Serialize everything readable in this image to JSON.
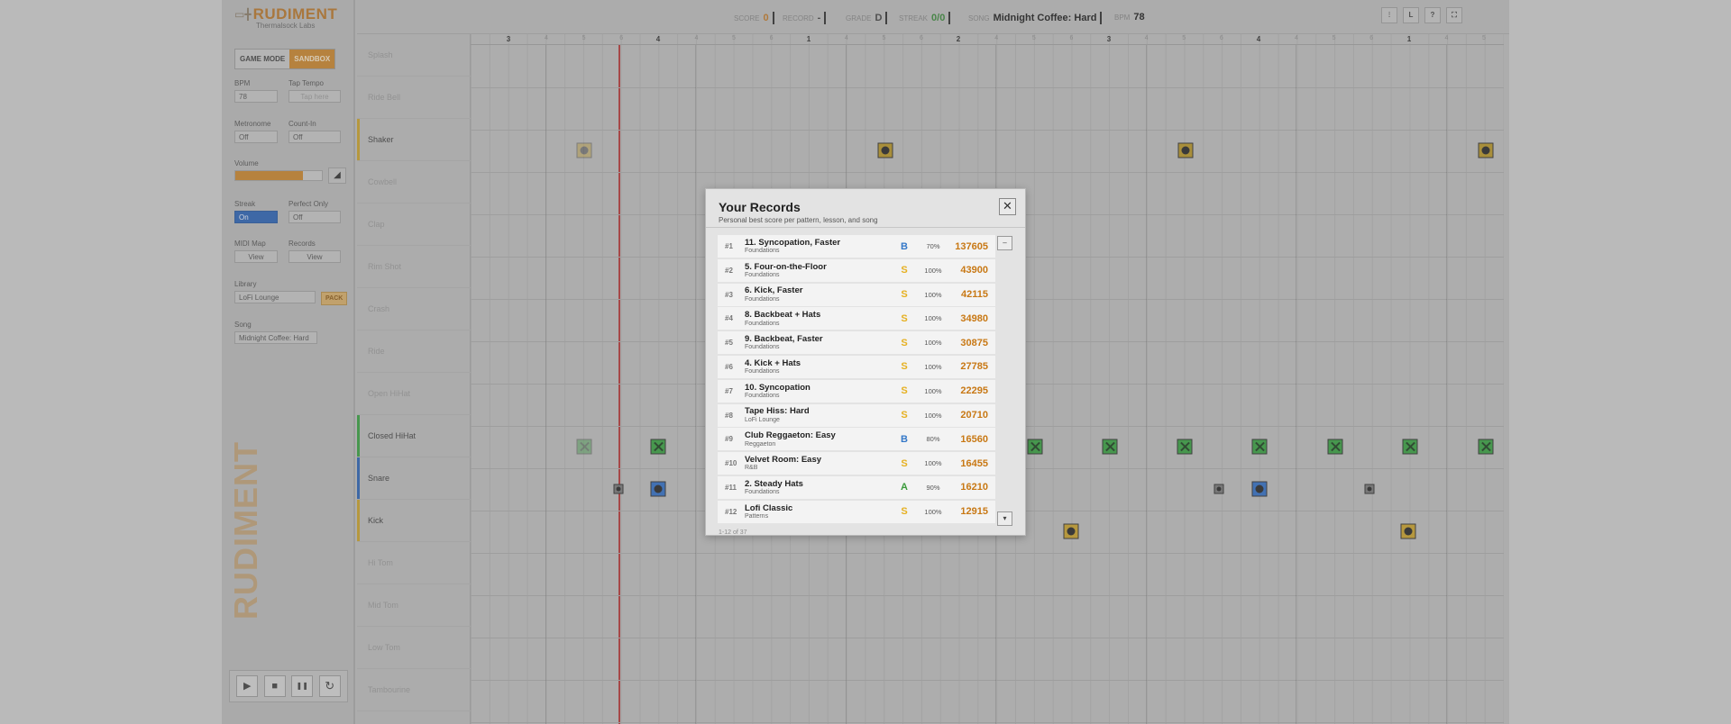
{
  "brand": {
    "name": "RUDIMENT",
    "sub": "Thermalsock Labs",
    "vertical": "RUDIMENT"
  },
  "modes": {
    "game": "GAME MODE",
    "sandbox": "SANDBOX"
  },
  "controls": {
    "bpm_label": "BPM",
    "bpm_value": "78",
    "tap_label": "Tap Tempo",
    "tap_placeholder": "Tap here",
    "metronome_label": "Metronome",
    "metronome_value": "Off",
    "countin_label": "Count-In",
    "countin_value": "Off",
    "volume_label": "Volume",
    "volume_level": 0.78,
    "streak_label": "Streak",
    "streak_value": "On",
    "perfect_label": "Perfect Only",
    "perfect_value": "Off",
    "midi_label": "MIDI Map",
    "midi_btn": "View",
    "records_label": "Records",
    "records_btn": "View",
    "library_label": "Library",
    "library_value": "LoFi Lounge",
    "pack_btn": "PACK",
    "song_label": "Song",
    "song_value": "Midnight Coffee: Hard"
  },
  "transport": {
    "play": "▶",
    "stop": "■",
    "pause": "❚❚",
    "loop": "↻"
  },
  "topbar": {
    "score_label": "SCORE",
    "score_value": "0",
    "record_label": "RECORD",
    "record_value": "-",
    "grade_label": "GRADE",
    "grade_value": "D",
    "streak_label": "STREAK",
    "streak_value": "0/0",
    "song_label": "SONG",
    "song_value": "Midnight Coffee: Hard",
    "bpm_label": "BPM",
    "bpm_value": "78",
    "btn_l": "L",
    "btn_help": "?"
  },
  "lanes": [
    "Splash",
    "Ride Bell",
    "Shaker",
    "Cowbell",
    "Clap",
    "Rim Shot",
    "Crash",
    "Ride",
    "Open HiHat",
    "Closed HiHat",
    "Snare",
    "Kick",
    "Hi Tom",
    "Mid Tom",
    "Low Tom",
    "Tambourine"
  ],
  "ruler": [
    "3",
    "4",
    "1",
    "2",
    "3",
    "4",
    "1"
  ],
  "ruler_minor": [
    "4",
    "5",
    "6",
    "4",
    "5",
    "6",
    "4",
    "5",
    "6",
    "4",
    "5",
    "6",
    "4",
    "5",
    "6",
    "4",
    "5",
    "6",
    "4",
    "5"
  ],
  "colors": {
    "accent": "#c8862f",
    "blue": "#2f64b4",
    "hihat_green": "#3aa043",
    "playhead": "#b43a3a"
  },
  "modal": {
    "title": "Your Records",
    "subtitle": "Personal best score per pattern, lesson, and song",
    "footer": "1-12 of 37",
    "rows": [
      {
        "rank": "#1",
        "name": "11. Syncopation, Faster",
        "cat": "Foundations",
        "grade": "B",
        "pct": "70%",
        "score": "137605"
      },
      {
        "rank": "#2",
        "name": "5. Four-on-the-Floor",
        "cat": "Foundations",
        "grade": "S",
        "pct": "100%",
        "score": "43900"
      },
      {
        "rank": "#3",
        "name": "6. Kick, Faster",
        "cat": "Foundations",
        "grade": "S",
        "pct": "100%",
        "score": "42115"
      },
      {
        "rank": "#4",
        "name": "8. Backbeat + Hats",
        "cat": "Foundations",
        "grade": "S",
        "pct": "100%",
        "score": "34980"
      },
      {
        "rank": "#5",
        "name": "9. Backbeat, Faster",
        "cat": "Foundations",
        "grade": "S",
        "pct": "100%",
        "score": "30875"
      },
      {
        "rank": "#6",
        "name": "4. Kick + Hats",
        "cat": "Foundations",
        "grade": "S",
        "pct": "100%",
        "score": "27785"
      },
      {
        "rank": "#7",
        "name": "10. Syncopation",
        "cat": "Foundations",
        "grade": "S",
        "pct": "100%",
        "score": "22295"
      },
      {
        "rank": "#8",
        "name": "Tape Hiss: Hard",
        "cat": "LoFi Lounge",
        "grade": "S",
        "pct": "100%",
        "score": "20710"
      },
      {
        "rank": "#9",
        "name": "Club Reggaeton: Easy",
        "cat": "Reggaeton",
        "grade": "B",
        "pct": "80%",
        "score": "16560"
      },
      {
        "rank": "#10",
        "name": "Velvet Room: Easy",
        "cat": "R&B",
        "grade": "S",
        "pct": "100%",
        "score": "16455"
      },
      {
        "rank": "#11",
        "name": "2. Steady Hats",
        "cat": "Foundations",
        "grade": "A",
        "pct": "90%",
        "score": "16210"
      },
      {
        "rank": "#12",
        "name": "Lofi Classic",
        "cat": "Patterns",
        "grade": "S",
        "pct": "100%",
        "score": "12915"
      }
    ]
  }
}
